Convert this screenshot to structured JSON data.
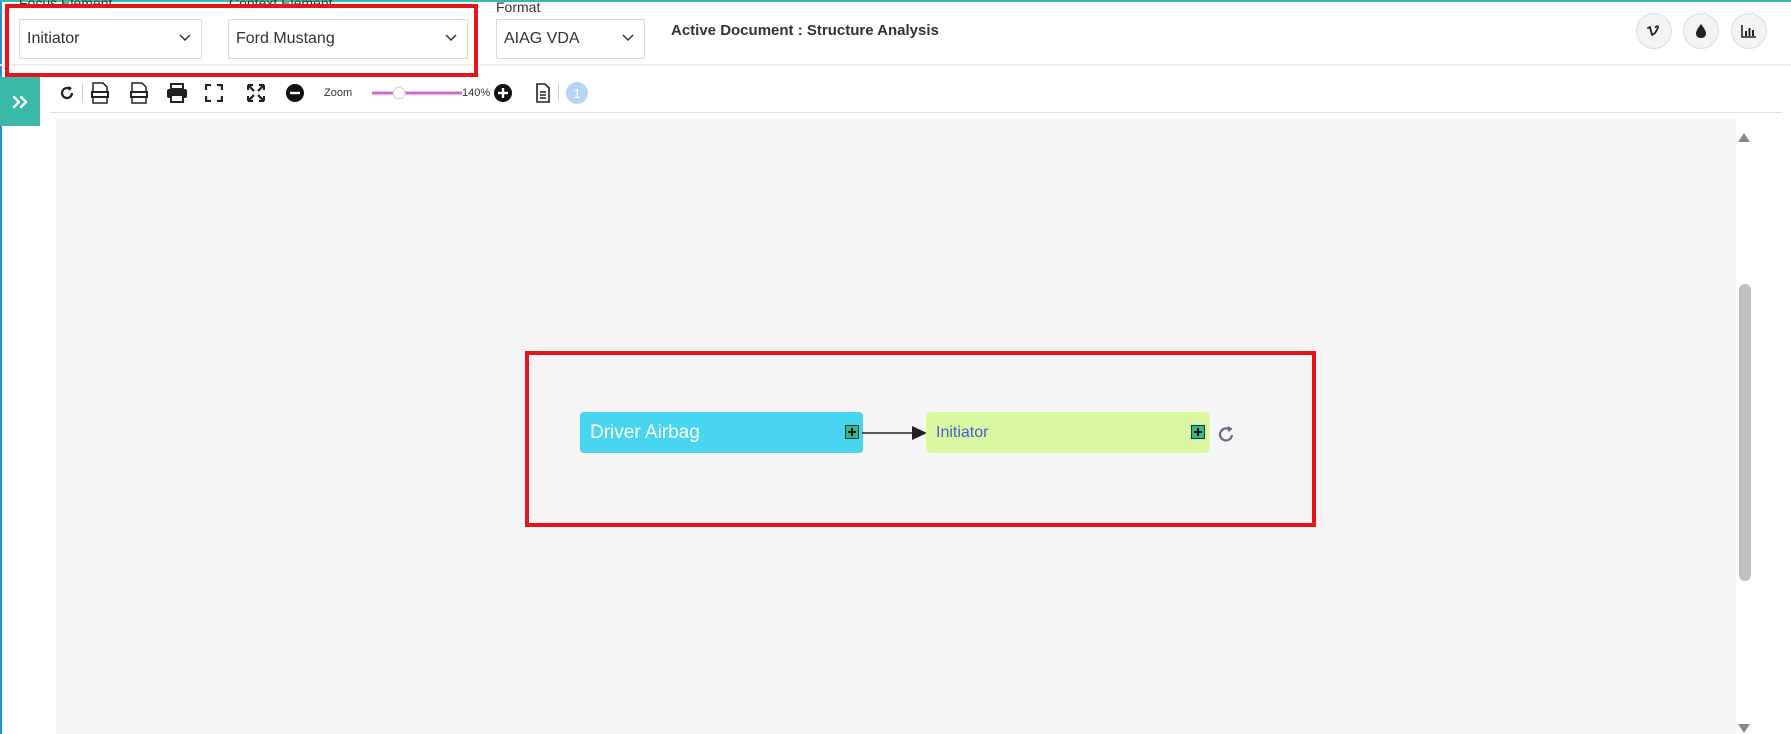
{
  "header": {
    "focus_element": {
      "label": "Focus Element",
      "value": "Initiator"
    },
    "context_element": {
      "label": "Context Element",
      "value": "Ford Mustang"
    },
    "format": {
      "label": "Format",
      "value": "AIAG VDA"
    },
    "active_document": "Active Document : Structure Analysis",
    "right_icons": [
      "vimeo-icon",
      "drop-icon",
      "bar-chart-icon"
    ]
  },
  "toolbar": {
    "icons": [
      "refresh-icon",
      "svg-export-icon",
      "png-export-icon",
      "print-icon",
      "fullscreen-icon",
      "fit-screen-icon",
      "zoom-out-icon",
      "zoom-in-icon",
      "document-icon"
    ],
    "zoom_label": "Zoom",
    "zoom_value": "140%",
    "zoom_level_fraction": 0.27,
    "badge_count": "1"
  },
  "diagram": {
    "nodes": [
      {
        "id": "driver-airbag",
        "label": "Driver Airbag",
        "color": "#48d5ef"
      },
      {
        "id": "initiator",
        "label": "Initiator",
        "color": "#d8f7a0"
      }
    ],
    "edges": [
      {
        "from": "driver-airbag",
        "to": "initiator"
      }
    ]
  },
  "colors": {
    "accent_teal": "#3bb9a8",
    "highlight_red": "#e8141b",
    "zoom_slider": "#d866d0"
  }
}
